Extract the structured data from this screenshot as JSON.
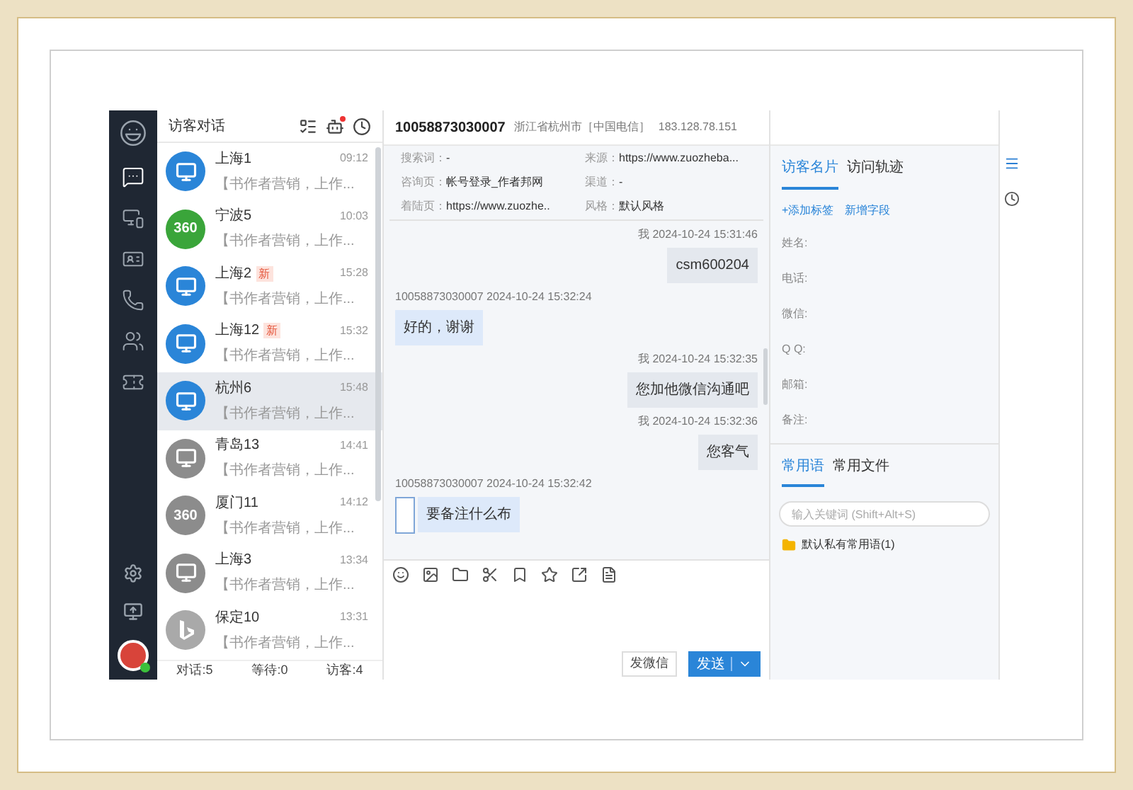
{
  "nav": [
    {
      "kind": "logo",
      "selected": false
    },
    {
      "kind": "chat",
      "selected": true
    },
    {
      "kind": "devices",
      "selected": false
    },
    {
      "kind": "card",
      "selected": false
    },
    {
      "kind": "phone",
      "selected": false
    },
    {
      "kind": "users",
      "selected": false
    },
    {
      "kind": "ticket",
      "selected": false
    }
  ],
  "nav_bottom": [
    {
      "kind": "settings"
    },
    {
      "kind": "screen"
    }
  ],
  "list": {
    "title": "访客对话",
    "header_icons": [
      {
        "kind": "list",
        "alert": false
      },
      {
        "kind": "bot",
        "alert": true
      },
      {
        "kind": "clock",
        "alert": false
      }
    ],
    "items": [
      {
        "name": "上海1",
        "time": "09:12",
        "preview": "【书作者营销，上作...",
        "avatar": {
          "kind": "pc"
        },
        "online": true,
        "selected": false
      },
      {
        "name": "宁波5",
        "time": "10:03",
        "preview": "【书作者营销，上作...",
        "avatar": {
          "kind": "logo",
          "label": "360"
        },
        "online": true,
        "selected": false
      },
      {
        "name": "上海2",
        "badge": "新",
        "time": "15:28",
        "preview": "【书作者营销，上作...",
        "avatar": {
          "kind": "pc"
        },
        "online": true,
        "selected": false
      },
      {
        "name": "上海12",
        "badge": "新",
        "time": "15:32",
        "preview": "【书作者营销，上作...",
        "avatar": {
          "kind": "pc"
        },
        "online": true,
        "selected": false
      },
      {
        "name": "杭州6",
        "time": "15:48",
        "preview": "【书作者营销，上作...",
        "avatar": {
          "kind": "pc"
        },
        "online": true,
        "selected": true
      },
      {
        "name": "青岛13",
        "time": "14:41",
        "preview": "【书作者营销，上作...",
        "avatar": {
          "kind": "pc"
        },
        "online": false,
        "selected": false
      },
      {
        "name": "厦门11",
        "time": "14:12",
        "preview": "【书作者营销，上作...",
        "avatar": {
          "kind": "logo",
          "label": "360"
        },
        "online": false,
        "selected": false
      },
      {
        "name": "上海3",
        "time": "13:34",
        "preview": "【书作者营销，上作...",
        "avatar": {
          "kind": "pc"
        },
        "online": false,
        "selected": false
      },
      {
        "name": "保定10",
        "time": "13:31",
        "preview": "【书作者营销，上作...",
        "avatar": {
          "kind": "bing"
        },
        "online": false,
        "selected": false
      }
    ],
    "footer": [
      "对话:5",
      "等待:0",
      "访客:4"
    ]
  },
  "chat": {
    "visitor_id": "10058873030007",
    "location": "浙江省杭州市［中国电信］",
    "ip": "183.128.78.151",
    "info": [
      {
        "field": "搜索词：",
        "text": "-"
      },
      {
        "field": "来源：",
        "text": "https://www.zuozheba..."
      },
      {
        "field": "咨询页：",
        "text": "帐号登录_作者邦网"
      },
      {
        "field": "渠道：",
        "text": "-"
      },
      {
        "field": "着陆页：",
        "text": "https://www.zuozhe.."
      },
      {
        "field": "风格：",
        "text": "默认风格"
      }
    ],
    "messages": [
      {
        "kind": "sent",
        "meta": "我 2024-10-24 15:31:46",
        "text": "csm600204"
      },
      {
        "kind": "received",
        "meta": "10058873030007 2024-10-24 15:32:24",
        "text": "好的，谢谢"
      },
      {
        "kind": "sent",
        "meta": "我 2024-10-24 15:32:35",
        "text": "您加他微信沟通吧"
      },
      {
        "kind": "sent",
        "meta": "我 2024-10-24 15:32:36",
        "text": "您客气"
      },
      {
        "kind": "received",
        "meta": "10058873030007 2024-10-24 15:32:42",
        "text": "要备注什么布",
        "attachment": true
      }
    ],
    "tools": [
      {
        "kind": "emoji"
      },
      {
        "kind": "image"
      },
      {
        "kind": "folder"
      },
      {
        "kind": "scissors"
      },
      {
        "kind": "bookmark"
      },
      {
        "kind": "star"
      },
      {
        "kind": "share"
      },
      {
        "kind": "note"
      }
    ],
    "buttons": [
      {
        "kind": "plain",
        "label": "发微信"
      },
      {
        "kind": "primary",
        "label": "发送"
      }
    ]
  },
  "profile": {
    "tabs": [
      {
        "label": "访客名片",
        "selected": true
      },
      {
        "label": "访问轨迹",
        "selected": false
      }
    ],
    "links": [
      "+添加标签",
      "新增字段"
    ],
    "fields": [
      "姓名:",
      "电话:",
      "微信:",
      "Q Q:",
      "邮箱:",
      "备注:"
    ]
  },
  "phrases": {
    "tabs": [
      {
        "label": "常用语",
        "selected": true
      },
      {
        "label": "常用文件",
        "selected": false
      }
    ],
    "search": {
      "placeholder": "输入关键词 (Shift+Alt+S)"
    },
    "folders": [
      "默认私有常用语(1)"
    ]
  },
  "side_icons": [
    {
      "kind": "menu"
    },
    {
      "kind": "clock"
    }
  ]
}
